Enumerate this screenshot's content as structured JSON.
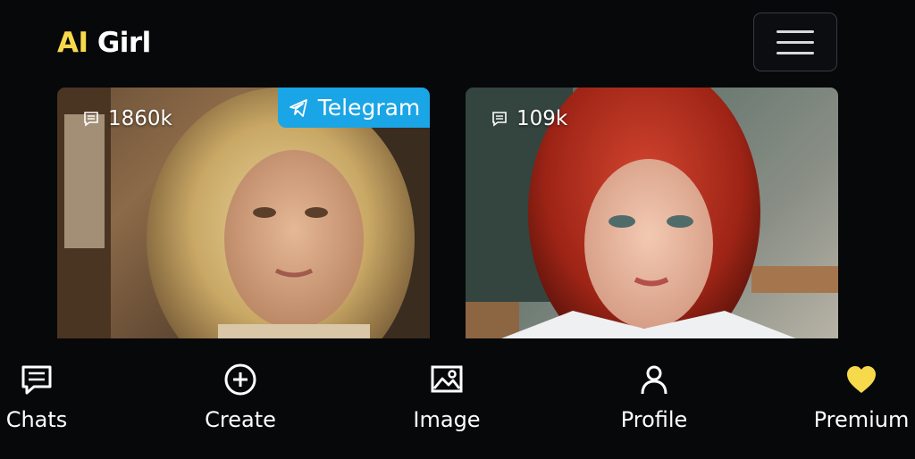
{
  "header": {
    "logo_ai": "AI",
    "logo_girl": "Girl"
  },
  "cards": [
    {
      "message_count": "1860k",
      "badge": "Telegram"
    },
    {
      "message_count": "109k"
    }
  ],
  "nav": {
    "items": [
      {
        "label": "Chats",
        "icon": "chat-icon"
      },
      {
        "label": "Create",
        "icon": "plus-circle-icon"
      },
      {
        "label": "Image",
        "icon": "image-icon"
      },
      {
        "label": "Profile",
        "icon": "person-icon"
      },
      {
        "label": "Premium",
        "icon": "heart-icon"
      }
    ]
  },
  "colors": {
    "background": "#07080a",
    "logo_accent": "#f7d94c",
    "telegram_badge": "#1aa5e6",
    "premium_heart": "#f7d94c"
  }
}
